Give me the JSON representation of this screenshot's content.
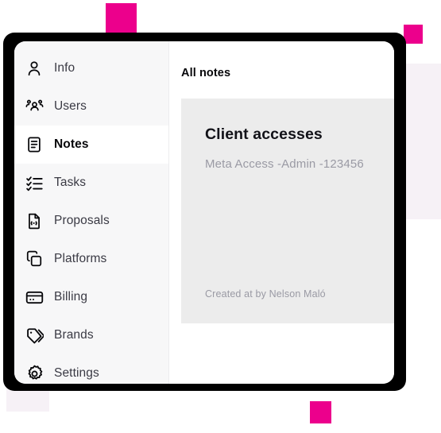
{
  "theme": {
    "accent_pink": "#EC008C",
    "lavender": "#F6F1F6",
    "frame_black": "#000000",
    "sidebar_bg": "#F7F7F8",
    "note_card_bg": "#ECECEC",
    "text_primary": "#07070A",
    "text_muted": "#9A9AA4"
  },
  "sidebar": {
    "items": [
      {
        "label": "Info",
        "icon": "user-icon",
        "active": false
      },
      {
        "label": "Users",
        "icon": "users-icon",
        "active": false
      },
      {
        "label": "Notes",
        "icon": "note-icon",
        "active": true
      },
      {
        "label": "Tasks",
        "icon": "checklist-icon",
        "active": false
      },
      {
        "label": "Proposals",
        "icon": "document-icon",
        "active": false
      },
      {
        "label": "Platforms",
        "icon": "copy-icon",
        "active": false
      },
      {
        "label": "Billing",
        "icon": "card-icon",
        "active": false
      },
      {
        "label": "Brands",
        "icon": "tag-icon",
        "active": false
      },
      {
        "label": "Settings",
        "icon": "gear-icon",
        "active": false
      }
    ]
  },
  "main": {
    "title": "All notes",
    "note": {
      "title": "Client accesses",
      "body": "Meta Access -Admin -123456",
      "meta": "Created at by Nelson Maló"
    }
  },
  "decorations": [
    {
      "name": "pink-square-top",
      "color": "#EC008C"
    },
    {
      "name": "pink-square-top-right",
      "color": "#EC008C"
    },
    {
      "name": "pink-square-bottom",
      "color": "#EC008C"
    },
    {
      "name": "lavender-block-right",
      "color": "#F6F1F6"
    },
    {
      "name": "lavender-block-bottom",
      "color": "#F6F1F6"
    }
  ]
}
